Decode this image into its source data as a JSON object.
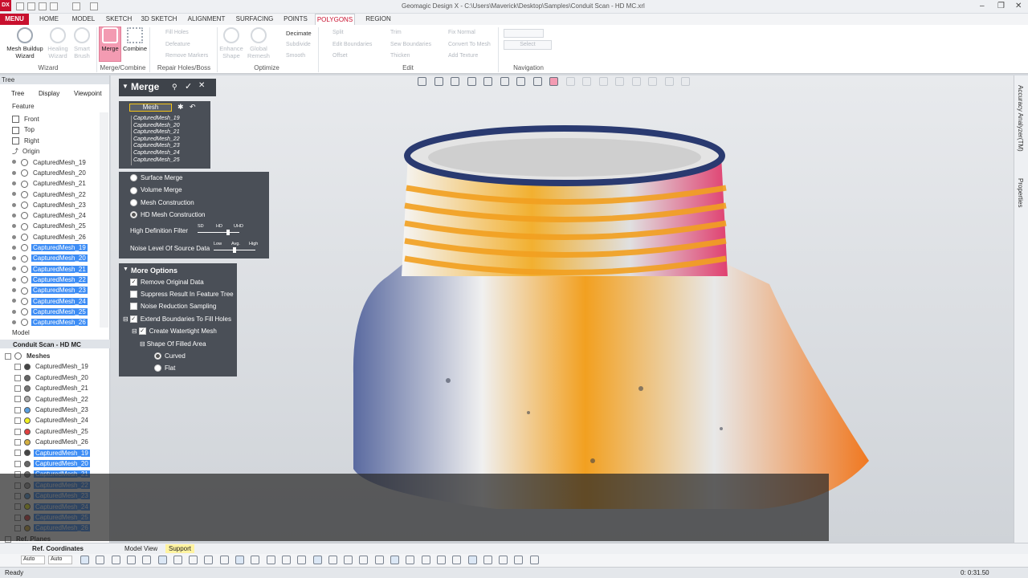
{
  "titlebar": {
    "title": "Geomagic Design X - C:\\Users\\Maverick\\Desktop\\Samples\\Conduit Scan - HD MC.xrl",
    "logo": "DX"
  },
  "menu": {
    "menu_label": "MENU",
    "tabs": [
      "HOME",
      "MODEL",
      "SKETCH",
      "3D SKETCH",
      "ALIGNMENT",
      "SURFACING",
      "POINTS",
      "POLYGONS",
      "REGION"
    ],
    "active_tab": "POLYGONS"
  },
  "ribbon": {
    "wizard": {
      "mesh_buildup": "Mesh Buildup Wizard",
      "healing": "Healing Wizard",
      "smart_brush": "Smart Brush",
      "group": "Wizard"
    },
    "merge_combine": {
      "merge": "Merge",
      "combine": "Combine",
      "group": "Merge/Combine"
    },
    "repair": {
      "items": [
        "Fill Holes",
        "Defeature",
        "Remove Markers"
      ],
      "group": "Repair Holes/Boss"
    },
    "optimize": {
      "enhance": "Enhance Shape",
      "global": "Global Remesh",
      "items": [
        "Decimate",
        "Subdivide",
        "Smooth"
      ],
      "group": "Optimize"
    },
    "edit": {
      "col1": [
        "Split",
        "Edit Boundaries",
        "Offset"
      ],
      "col2": [
        "Trim",
        "Sew Boundaries",
        "Thicken"
      ],
      "col3": [
        "Fix Normal",
        "Convert To Mesh",
        "Add Texture"
      ],
      "group": "Edit"
    },
    "navigation": {
      "select": "Select",
      "group": "Navigation"
    }
  },
  "tree": {
    "header": "Tree",
    "tabs": [
      "Tree",
      "Display",
      "Viewpoint"
    ],
    "feature_label": "Feature",
    "planes": [
      "Front",
      "Top",
      "Right"
    ],
    "origin": "Origin",
    "meshes": [
      "CapturedMesh_19",
      "CapturedMesh_20",
      "CapturedMesh_21",
      "CapturedMesh_22",
      "CapturedMesh_23",
      "CapturedMesh_24",
      "CapturedMesh_25",
      "CapturedMesh_26",
      "CapturedMesh_19",
      "CapturedMesh_20",
      "CapturedMesh_21",
      "CapturedMesh_22",
      "CapturedMesh_23",
      "CapturedMesh_24",
      "CapturedMesh_25",
      "CapturedMesh_26"
    ],
    "model_label": "Model",
    "model_name": "Conduit Scan - HD MC",
    "meshes_group": "Meshes",
    "model_meshes": [
      "CapturedMesh_19",
      "CapturedMesh_20",
      "CapturedMesh_21",
      "CapturedMesh_22",
      "CapturedMesh_23",
      "CapturedMesh_24",
      "CapturedMesh_25",
      "CapturedMesh_26",
      "CapturedMesh_19",
      "CapturedMesh_20",
      "CapturedMesh_21",
      "CapturedMesh_22",
      "CapturedMesh_23",
      "CapturedMesh_24",
      "CapturedMesh_25",
      "CapturedMesh_26"
    ],
    "mesh_colors": [
      "#444444",
      "#666666",
      "#777777",
      "#aaaaaa",
      "#5aa0e0",
      "#f0f020",
      "#e04040",
      "#d4b040"
    ],
    "ref_planes": "Ref. Planes",
    "ref_coords": "Ref. Coordinates"
  },
  "merge": {
    "title": "Merge",
    "mesh_label": "Mesh",
    "mesh_list": [
      "CapturedMesh_19",
      "CapturedMesh_20",
      "CapturedMesh_21",
      "CapturedMesh_22",
      "CapturedMesh_23",
      "CapturedMesh_24",
      "CapturedMesh_25"
    ],
    "methods": [
      "Surface Merge",
      "Volume Merge",
      "Mesh Construction",
      "HD Mesh Construction"
    ],
    "selected_method": "HD Mesh Construction",
    "hd_filter": {
      "label": "High Definition Filter",
      "ticks": [
        "SD",
        "HD",
        "UHD"
      ]
    },
    "noise": {
      "label": "Noise Level Of Source Data",
      "ticks": [
        "Low",
        "Avg.",
        "High"
      ]
    },
    "more_options": "More Options",
    "checks": [
      "Remove Original Data",
      "Suppress Result In Feature Tree",
      "Noise Reduction Sampling",
      "Extend Boundaries To Fill Holes",
      "Create Watertight Mesh"
    ],
    "shape_label": "Shape Of Filled Area",
    "shapes": [
      "Curved",
      "Flat"
    ]
  },
  "right_dock": {
    "accuracy": "Accuracy Analyzer(TM)",
    "properties": "Properties"
  },
  "bottom": {
    "tabs": [
      "Model View",
      "Support"
    ],
    "auto1": "Auto",
    "auto2": "Auto",
    "status": "Ready",
    "time": "0: 0:31.50"
  }
}
